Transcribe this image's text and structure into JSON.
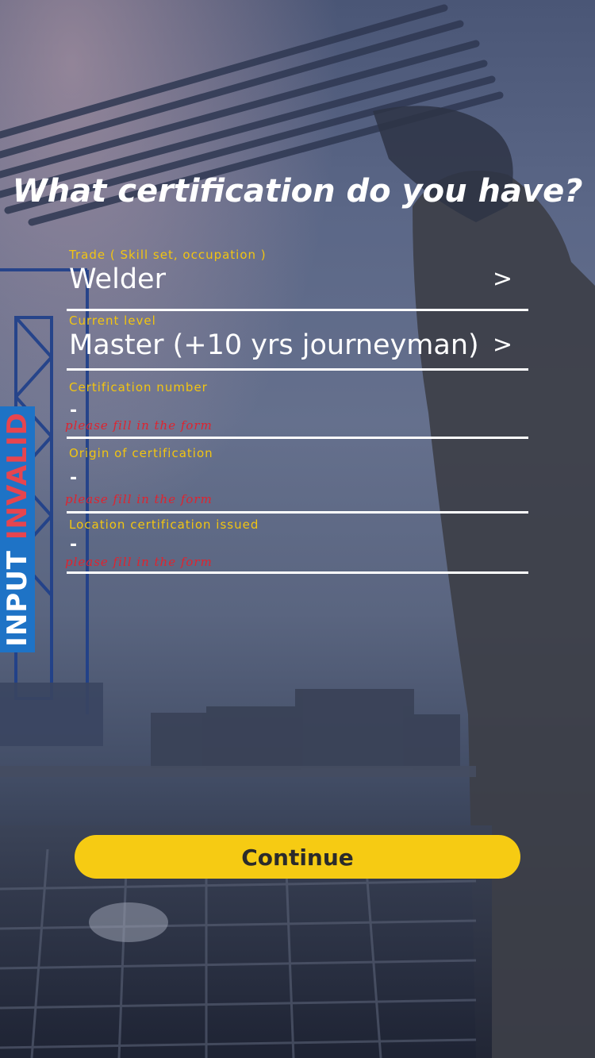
{
  "page": {
    "title": "What certification do you have?"
  },
  "form": {
    "fields": [
      {
        "label": "Trade ( Skill set, occupation )",
        "value": "Welder",
        "chevron": ">"
      },
      {
        "label": "Current level",
        "value": "Master (+10 yrs journeyman)",
        "chevron": ">"
      },
      {
        "label": "Certification number",
        "value": "-",
        "error": "please fill in the form"
      },
      {
        "label": "Origin of certification",
        "value": "-",
        "error": "please fill in the form"
      },
      {
        "label": "Location certification issued",
        "value": "-",
        "error": "please fill in the form"
      }
    ]
  },
  "side_badge": {
    "prefix": "INPUT",
    "status": "INVALID"
  },
  "actions": {
    "continue_label": "Continue"
  },
  "colors": {
    "label": "#f2c511",
    "error": "#e0232e",
    "button": "#f6cb13",
    "badge": "#1e73c6",
    "badge_status": "#e6454f"
  }
}
